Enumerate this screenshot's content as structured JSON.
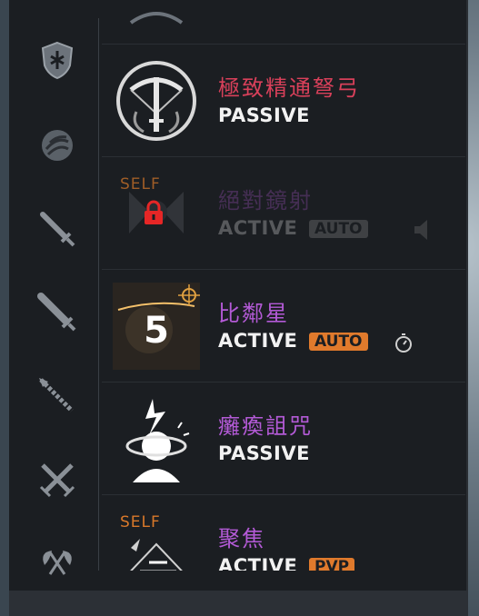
{
  "colors": {
    "panel_bg": "#1b1e22",
    "legendary_name": "#d8405a",
    "epic_name": "#b35ad6",
    "badge_orange": "#e07a2c",
    "lock_red": "#e62626"
  },
  "sidebar": {
    "icons": [
      {
        "name": "shield-icon"
      },
      {
        "name": "orb-icon"
      },
      {
        "name": "short-sword-icon"
      },
      {
        "name": "greatsword-icon"
      },
      {
        "name": "spear-icon"
      },
      {
        "name": "crossed-swords-icon"
      },
      {
        "name": "double-axe-icon"
      }
    ]
  },
  "skills": [
    {
      "name": "極致精通弩弓",
      "type": "PASSIVE",
      "badge": "",
      "icon": "crossbow-icon",
      "rarity": "legendary"
    },
    {
      "name": "絕對鏡射",
      "type": "ACTIVE",
      "badge": "AUTO",
      "self_tag": "SELF",
      "locked": true,
      "icon": "mirror-icon",
      "rarity": "epic"
    },
    {
      "name": "比鄰星",
      "type": "ACTIVE",
      "badge": "AUTO",
      "icon": "proxima-star-icon",
      "icon_number": "5",
      "has_timer": true,
      "rarity": "epic"
    },
    {
      "name": "癱瘓詛咒",
      "type": "PASSIVE",
      "badge": "",
      "icon": "paralysis-curse-icon",
      "rarity": "epic"
    },
    {
      "name": "聚焦",
      "type": "ACTIVE",
      "badge": "PVP",
      "self_tag": "SELF",
      "icon": "focus-icon",
      "rarity": "epic"
    }
  ]
}
